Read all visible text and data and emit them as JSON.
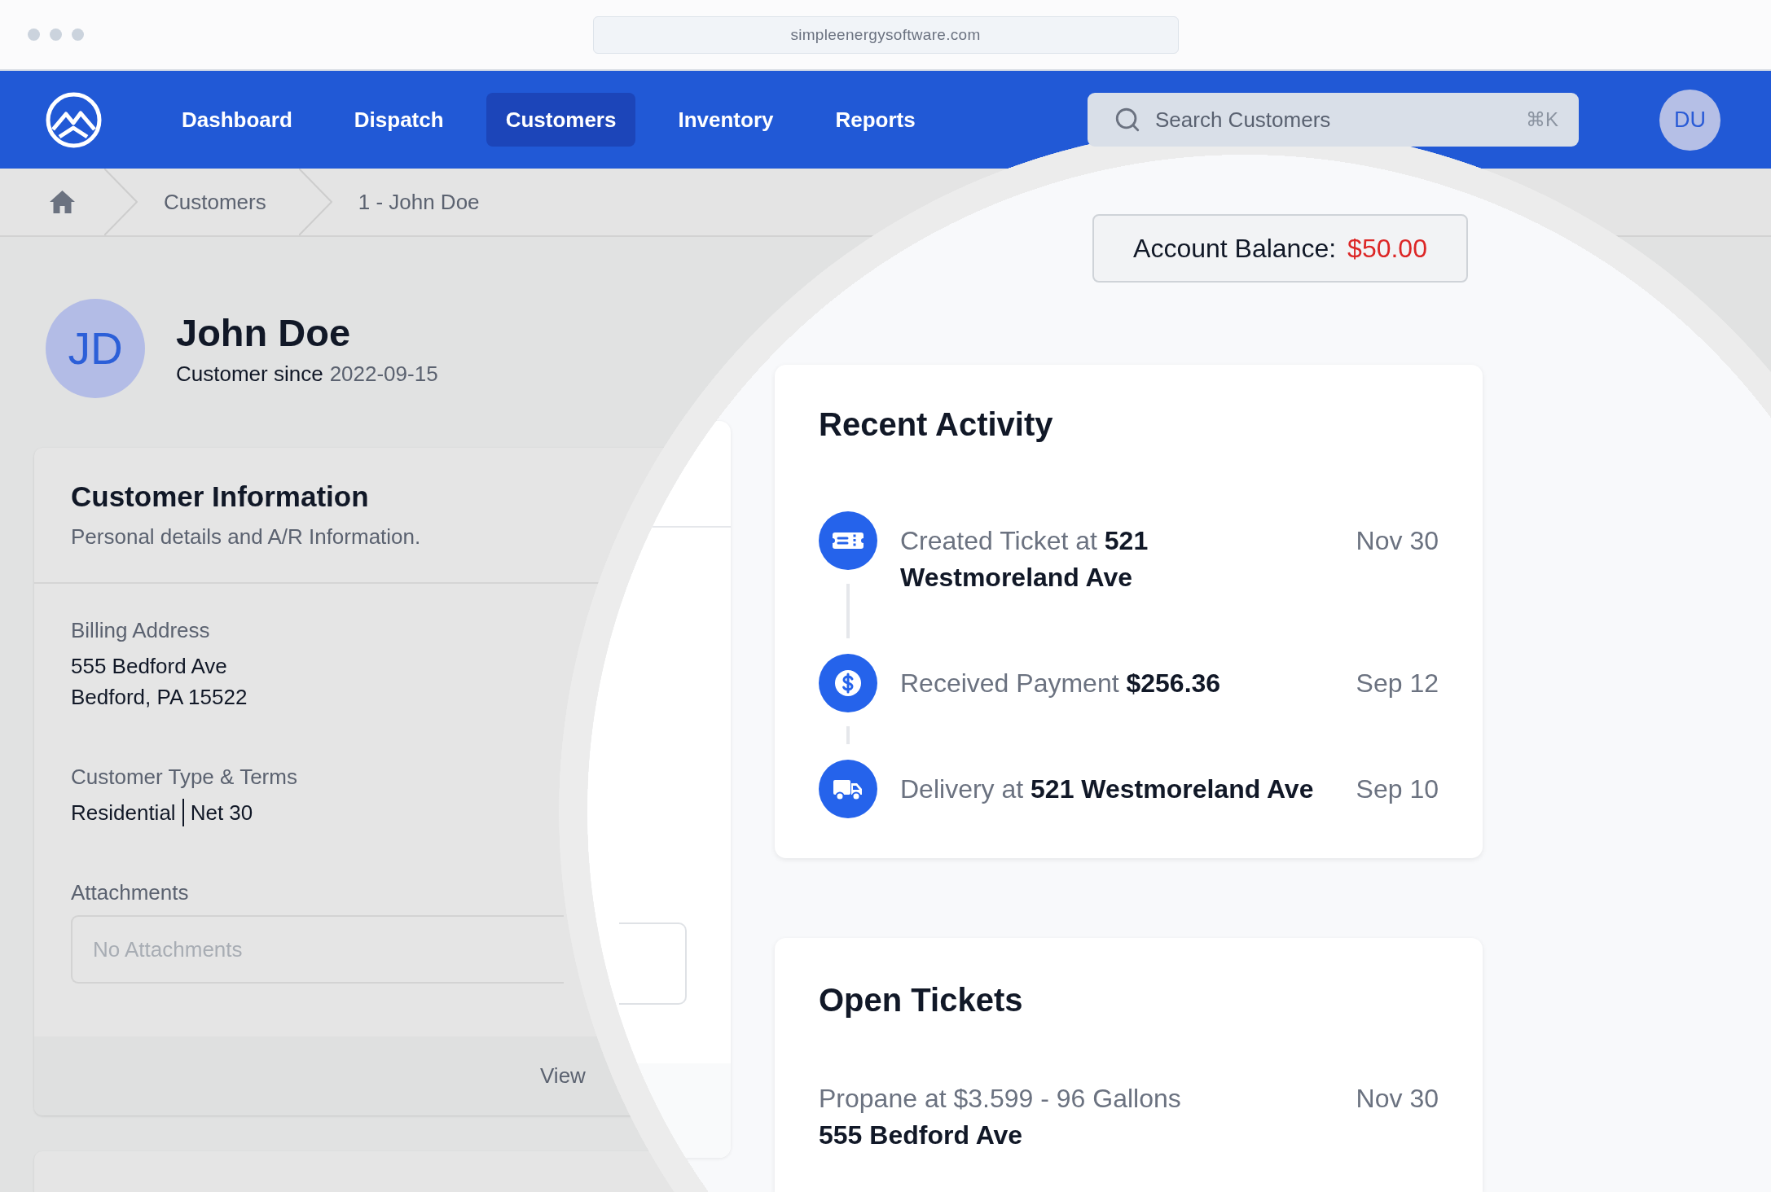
{
  "browser": {
    "url": "simpleenergysoftware.com"
  },
  "navbar": {
    "items": [
      {
        "label": "Dashboard",
        "selected": false
      },
      {
        "label": "Dispatch",
        "selected": false
      },
      {
        "label": "Customers",
        "selected": true
      },
      {
        "label": "Inventory",
        "selected": false
      },
      {
        "label": "Reports",
        "selected": false
      }
    ],
    "search": {
      "placeholder": "Search Customers",
      "shortcut": "⌘K"
    },
    "user_initials": "DU"
  },
  "breadcrumb": [
    "Customers",
    "1 - John Doe"
  ],
  "customer": {
    "initials": "JD",
    "name": "John Doe",
    "since_label": "Customer since",
    "since_date": "2022-09-15"
  },
  "customer_information": {
    "title": "Customer Information",
    "subtitle": "Personal details and A/R Information.",
    "fields": [
      {
        "kind": "lines",
        "label": "Billing Address",
        "values": [
          "555 Bedford Ave",
          "Bedford, PA 15522"
        ]
      },
      {
        "kind": "inline",
        "label": "Customer Type & Terms",
        "values": [
          "Residential",
          "Net 30"
        ]
      },
      {
        "kind": "attachments",
        "label": "Attachments",
        "placeholder": "No Attachments"
      }
    ],
    "footer_link": "View"
  },
  "account_balance": {
    "label": "Account Balance:",
    "amount": "$50.00"
  },
  "recent_activity": {
    "title": "Recent Activity",
    "items": [
      {
        "kind": "ticket",
        "text": "Created Ticket at **521 Westmoreland Ave**",
        "date": "Nov 30"
      },
      {
        "kind": "payment",
        "text": "Received Payment **$256.36**",
        "date": "Sep 12"
      },
      {
        "kind": "delivery",
        "text": "Delivery at **521 Westmoreland Ave**",
        "date": "Sep 10"
      }
    ]
  },
  "open_tickets": {
    "title": "Open Tickets",
    "items": [
      {
        "description": "Propane at $3.599 - 96 Gallons",
        "address": "555 Bedford Ave",
        "date": "Nov 30"
      }
    ]
  }
}
